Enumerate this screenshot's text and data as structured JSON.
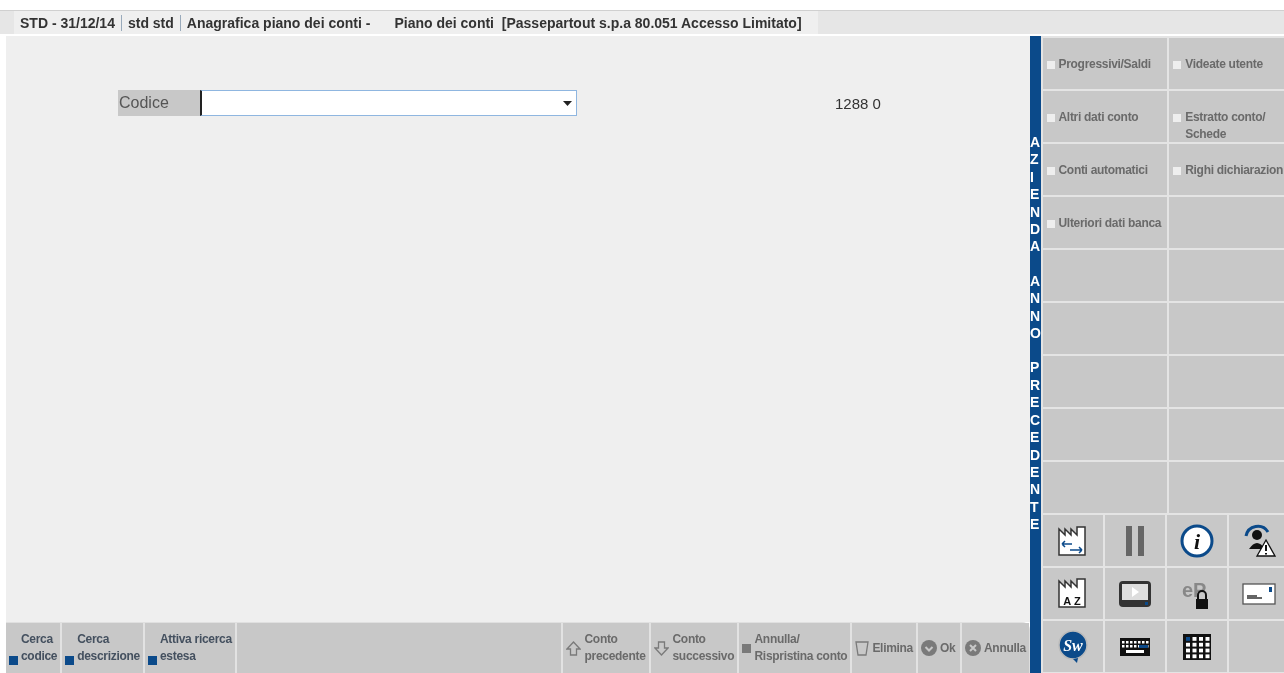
{
  "title_bar": {
    "segments": [
      "STD - 31/12/14",
      "std std",
      "Anagrafica piano dei conti -",
      "Piano dei conti  [Passepartout s.p.a 80.051 Accesso Limitato]"
    ]
  },
  "form": {
    "field_label": "Codice",
    "dropdown_open": false,
    "counter": "1288 0"
  },
  "toolbar": {
    "left_buttons": [
      {
        "label": "Cerca\ncodice",
        "kind": "square",
        "disabled": false
      },
      {
        "label": "Cerca\ndescrizione",
        "kind": "square",
        "disabled": false
      },
      {
        "label": "Attiva ricerca\nestesa",
        "kind": "square",
        "disabled": false
      }
    ],
    "right_buttons": [
      {
        "label": "Conto\nprecedente",
        "kind": "up",
        "disabled": true
      },
      {
        "label": "Conto\nsuccessivo",
        "kind": "down",
        "disabled": true
      },
      {
        "label": "Annulla/\nRispristina conto",
        "kind": "square",
        "disabled": true
      },
      {
        "label": "Elimina",
        "kind": "trash",
        "disabled": true
      },
      {
        "label": "Ok",
        "kind": "check",
        "disabled": true
      },
      {
        "label": "Annulla",
        "kind": "cross",
        "disabled": true
      }
    ]
  },
  "side_tab": {
    "words": [
      "AZIENDA",
      "ANNO",
      "PRECEDENTE"
    ]
  },
  "function_buttons": [
    {
      "label": "Progressivi/Saldi",
      "disabled": true
    },
    {
      "label": "Videate utente",
      "disabled": true
    },
    {
      "label": "Altri dati conto",
      "disabled": true
    },
    {
      "label": "Estratto conto/\nSchede",
      "disabled": true
    },
    {
      "label": "Conti automatici",
      "disabled": true
    },
    {
      "label": "Righi dichiarazion",
      "disabled": true
    },
    {
      "label": "Ulteriori dati banca",
      "disabled": true
    }
  ],
  "tool_buttons": [
    {
      "kind": "factory-transfer"
    },
    {
      "kind": "pause"
    },
    {
      "kind": "info",
      "text": "i"
    },
    {
      "kind": "user-warning"
    },
    {
      "kind": "factory-sort",
      "text": "A Z"
    },
    {
      "kind": "screen-play"
    },
    {
      "kind": "lock-logo",
      "text": "eP"
    },
    {
      "kind": "card"
    },
    {
      "kind": "bubble-logo",
      "text": "Sw"
    },
    {
      "kind": "keyboard"
    },
    {
      "kind": "keypad"
    }
  ]
}
